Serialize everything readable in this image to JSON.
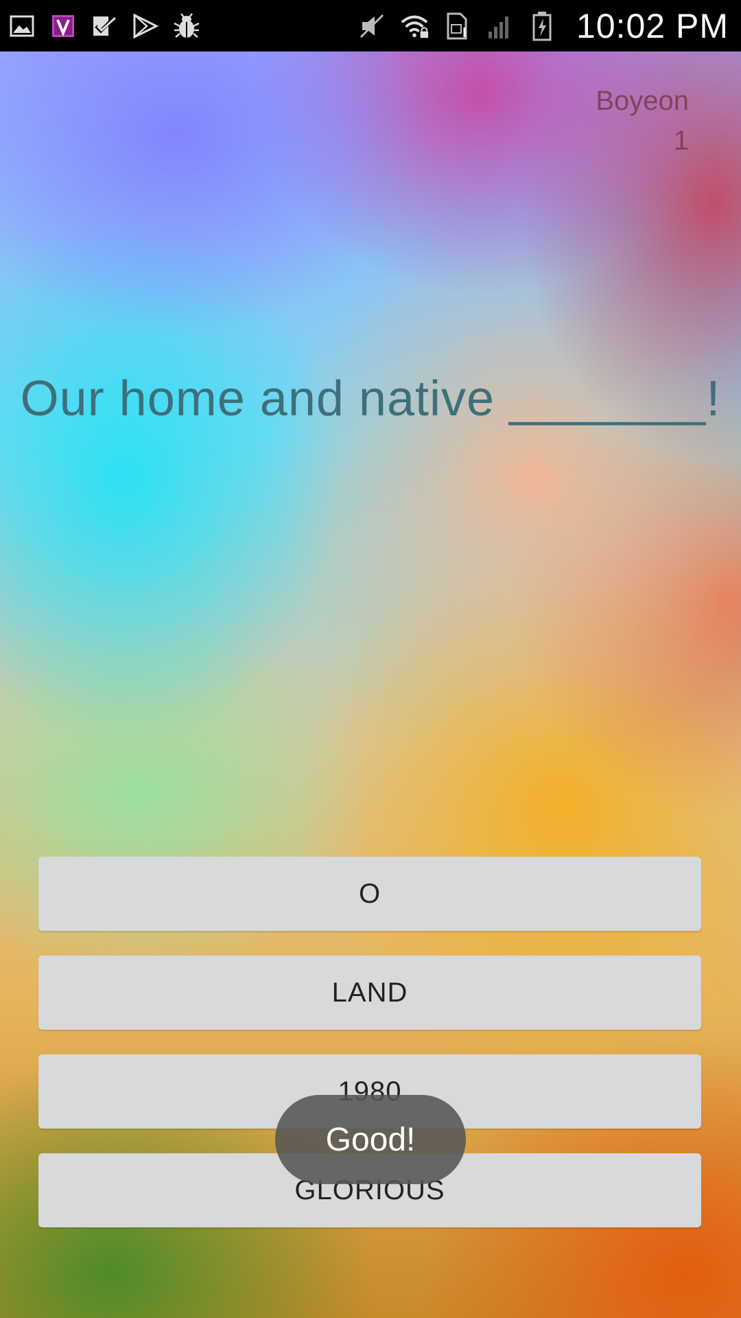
{
  "status_bar": {
    "time": "10:02 PM",
    "left_icons": [
      "gallery-icon",
      "v-app-icon",
      "task-check-icon",
      "play-store-icon",
      "bug-icon"
    ],
    "right_icons": [
      "mute-icon",
      "wifi-lock-icon",
      "sim-icon",
      "signal-icon",
      "battery-charging-icon"
    ]
  },
  "player": {
    "name": "Boyeon",
    "score": "1"
  },
  "question": {
    "text": "Our home and native _______!"
  },
  "answers": [
    {
      "label": "O"
    },
    {
      "label": "LAND"
    },
    {
      "label": "1980"
    },
    {
      "label": "GLORIOUS"
    }
  ],
  "toast": {
    "text": "Good!"
  }
}
